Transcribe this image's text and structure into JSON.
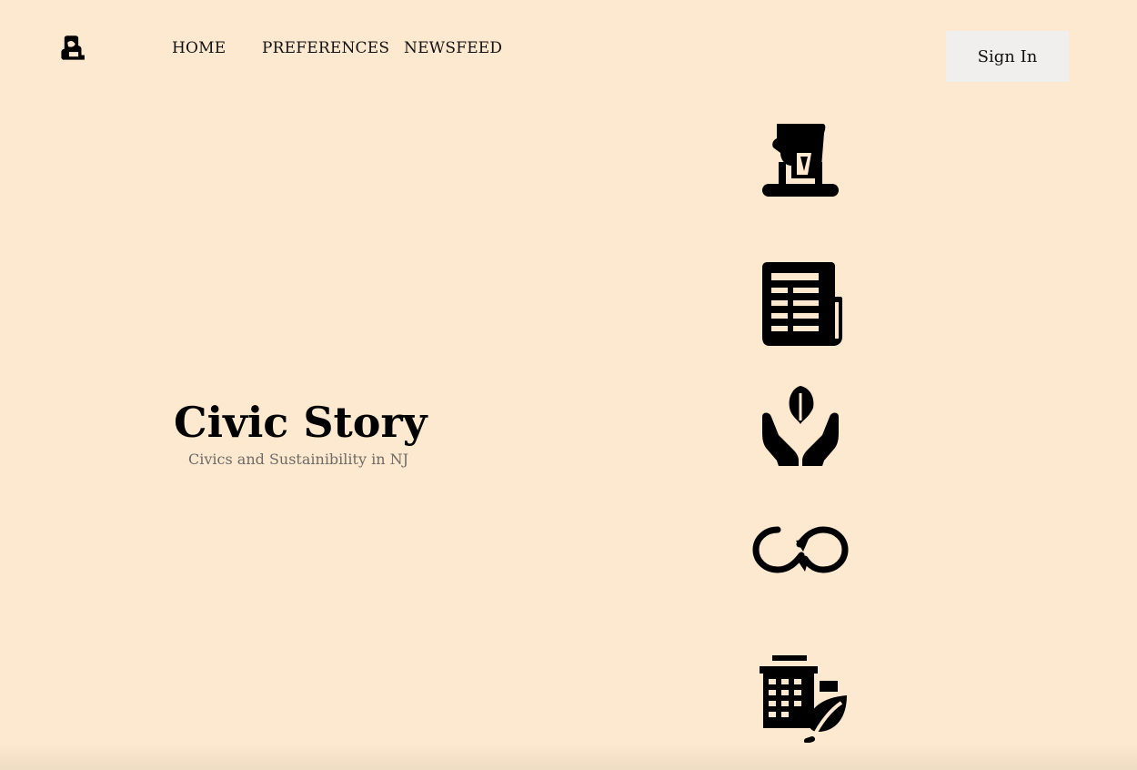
{
  "header": {
    "logo_icon": "hand-ballot-icon",
    "nav": {
      "home": "HOME",
      "preferences": "PREFERENCES",
      "newsfeed": "NEWSFEED"
    },
    "sign_in_label": "Sign In"
  },
  "hero": {
    "title": "Civic Story",
    "subtitle": "Civics and Sustainibility in NJ"
  },
  "features": {
    "icons": [
      "vote-ballot-icon",
      "newspaper-icon",
      "hands-seedling-icon",
      "recycle-infinity-icon",
      "eco-building-icon"
    ]
  },
  "colors": {
    "background": "#fde9cf",
    "button_bg": "#f0efed",
    "text": "#111111",
    "subtitle": "#6e6a66"
  }
}
